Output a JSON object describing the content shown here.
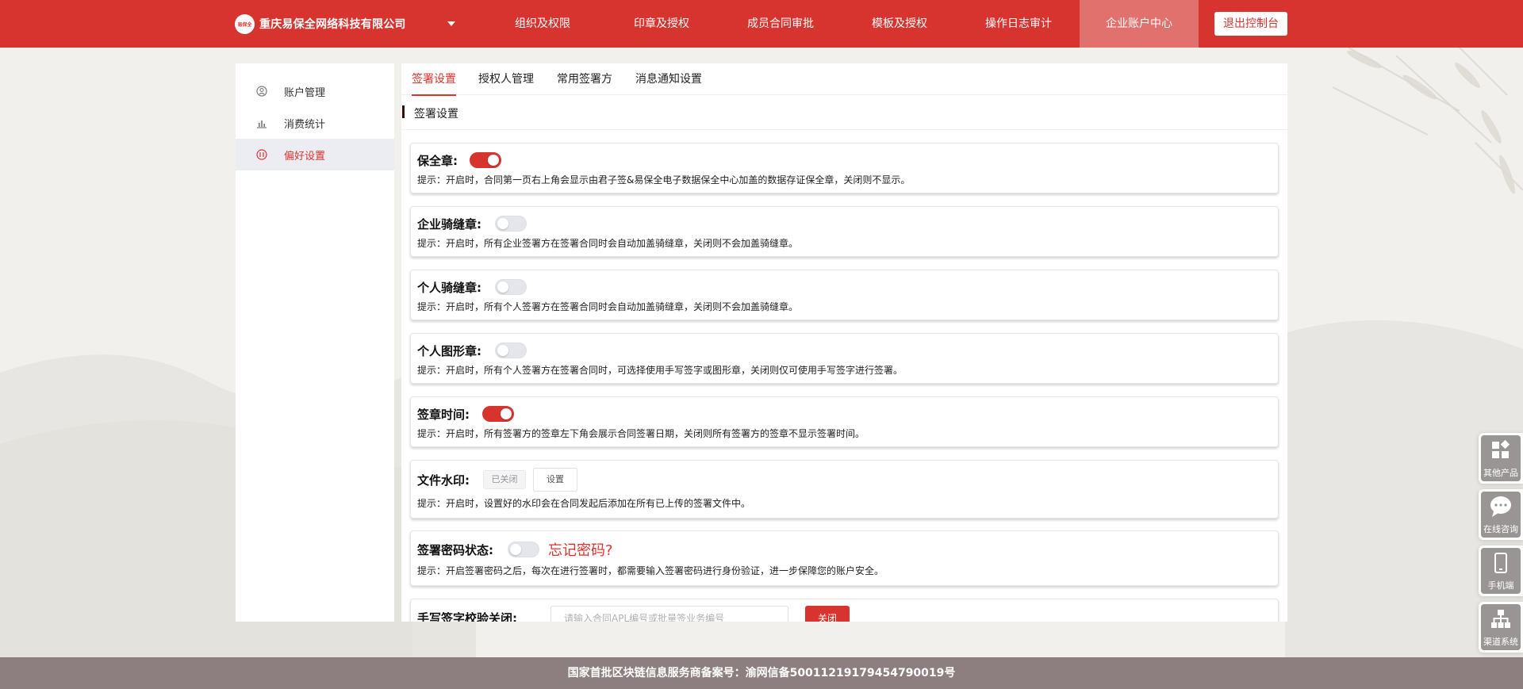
{
  "header": {
    "company_name": "重庆易保全网络科技有限公司",
    "logo_text": "易保全",
    "nav": [
      {
        "label": "组织及权限"
      },
      {
        "label": "印章及授权"
      },
      {
        "label": "成员合同审批"
      },
      {
        "label": "模板及授权"
      },
      {
        "label": "操作日志审计"
      },
      {
        "label": "企业账户中心",
        "active": true
      }
    ],
    "logout_label": "退出控制台",
    "accent_color": "#d8342f"
  },
  "sidebar": {
    "items": [
      {
        "label": "账户管理",
        "icon": "user-circle-icon"
      },
      {
        "label": "消费统计",
        "icon": "bar-chart-icon"
      },
      {
        "label": "偏好设置",
        "icon": "settings-circle-icon",
        "active": true
      }
    ]
  },
  "tabs": [
    {
      "label": "签署设置",
      "active": true
    },
    {
      "label": "授权人管理"
    },
    {
      "label": "常用签署方"
    },
    {
      "label": "消息通知设置"
    }
  ],
  "section_title": "签署设置",
  "settings": {
    "seal": {
      "title": "保全章:",
      "enabled": true,
      "tip": "提示：开启时，合同第一页右上角会显示由君子签&易保全电子数据保全中心加盖的数据存证保全章，关闭则不显示。"
    },
    "corp_riding_seal": {
      "title": "企业骑缝章:",
      "enabled": false,
      "tip": "提示：开启时，所有企业签署方在签署合同时会自动加盖骑缝章，关闭则不会加盖骑缝章。"
    },
    "personal_riding_seal": {
      "title": "个人骑缝章:",
      "enabled": false,
      "tip": "提示：开启时，所有个人签署方在签署合同时会自动加盖骑缝章，关闭则不会加盖骑缝章。"
    },
    "personal_graphic_seal": {
      "title": "个人图形章:",
      "enabled": false,
      "tip": "提示：开启时，所有个人签署方在签署合同时，可选择使用手写签字或图形章，关闭则仅可使用手写签字进行签署。"
    },
    "sign_time": {
      "title": "签章时间:",
      "enabled": true,
      "tip": "提示：开启时，所有签署方的签章左下角会展示合同签署日期，关闭则所有签署方的签章不显示签署时间。"
    },
    "watermark": {
      "title": "文件水印:",
      "status": "已关闭",
      "set_label": "设置",
      "tip": "提示：开启时，设置好的水印会在合同发起后添加在所有已上传的签署文件中。"
    },
    "sign_password": {
      "title": "签署密码状态:",
      "enabled": false,
      "forgot_label": "忘记密码?",
      "tip": "提示：开启签署密码之后，每次在进行签署时，都需要输入签署密码进行身份验证，进一步保障您的账户安全。"
    },
    "handwriting_check": {
      "title": "手写签字校验关闭:",
      "placeholder": "请输入合同APL编号或批量签业务编号",
      "close_label": "关闭"
    }
  },
  "float_widgets": [
    {
      "label": "其他产品",
      "icon": "grid-icon"
    },
    {
      "label": "在线咨询",
      "icon": "chat-icon"
    },
    {
      "label": "手机端",
      "icon": "mobile-icon"
    },
    {
      "label": "渠道系统",
      "icon": "org-chart-icon"
    }
  ],
  "footer": {
    "text": "国家首批区块链信息服务商备案号：渝网信备50011219179454790019号"
  }
}
